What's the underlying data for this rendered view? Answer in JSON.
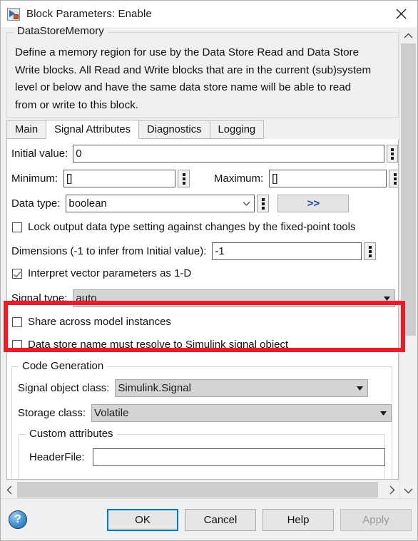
{
  "window": {
    "title": "Block Parameters: Enable",
    "icon": "simulink-block-icon",
    "close_label": "✕"
  },
  "description": {
    "legend": "DataStoreMemory",
    "lines": [
      "Define a memory region for use by the Data Store Read and Data Store",
      "Write blocks. All Read and Write blocks that are in the current (sub)system",
      "level or below and have the same data store name will be able to read",
      "from or write to this block."
    ]
  },
  "tabs": [
    {
      "label": "Main",
      "active": false
    },
    {
      "label": "Signal Attributes",
      "active": true
    },
    {
      "label": "Diagnostics",
      "active": false
    },
    {
      "label": "Logging",
      "active": false
    }
  ],
  "form": {
    "initial_value": {
      "label": "Initial value:",
      "value": "0"
    },
    "minimum": {
      "label": "Minimum:",
      "value": "[]"
    },
    "maximum": {
      "label": "Maximum:",
      "value": "[]"
    },
    "data_type": {
      "label": "Data type:",
      "value": "boolean"
    },
    "show_data_type_assistant": {
      "label": ">>"
    },
    "lock_output": {
      "label": "Lock output data type setting against changes by the fixed-point tools",
      "checked": false
    },
    "dimensions": {
      "label": "Dimensions (-1 to infer from Initial value):",
      "value": "-1"
    },
    "interpret_vector": {
      "label": "Interpret vector parameters as 1-D",
      "checked": true
    },
    "signal_type": {
      "label": "Signal type:",
      "value": "auto"
    },
    "share_across": {
      "label": "Share across model instances",
      "checked": false
    },
    "must_resolve": {
      "label": "Data store name must resolve to Simulink signal object",
      "checked": false
    }
  },
  "code_generation": {
    "legend": "Code Generation",
    "signal_object_class": {
      "label": "Signal object class:",
      "value": "Simulink.Signal"
    },
    "storage_class": {
      "label": "Storage class:",
      "value": "Volatile"
    },
    "custom_attributes": {
      "legend": "Custom attributes",
      "header_file": {
        "label": "HeaderFile:",
        "value": ""
      }
    }
  },
  "annotation": {
    "highlight_color": "#ee1b24",
    "target": "storage-class-group"
  },
  "footer": {
    "help_icon": "?",
    "buttons": [
      {
        "label": "OK",
        "state": "default"
      },
      {
        "label": "Cancel",
        "state": "normal"
      },
      {
        "label": "Help",
        "state": "normal"
      },
      {
        "label": "Apply",
        "state": "disabled"
      }
    ]
  },
  "scrollbars": {
    "vertical": {
      "up": "⌃",
      "down": "⌄"
    },
    "horizontal": {
      "left": "‹",
      "right": "›"
    }
  }
}
